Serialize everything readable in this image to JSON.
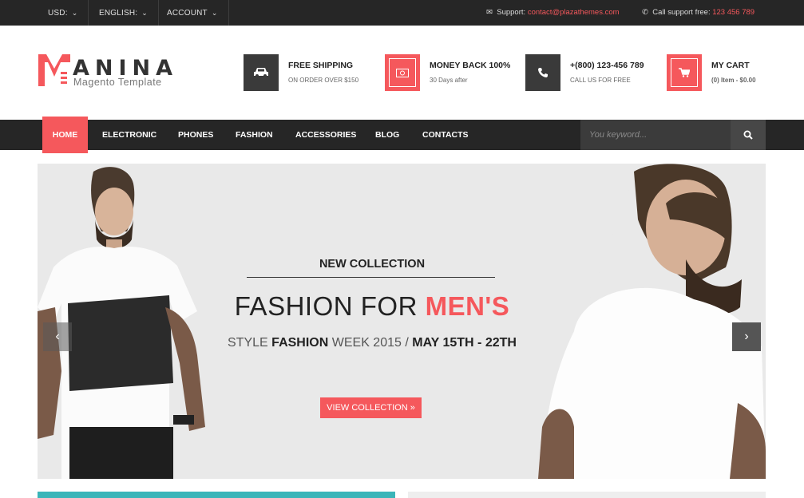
{
  "topbar": {
    "currency": "USD:",
    "language": "ENGLISH:",
    "account": "ACCOUNT",
    "support_label": "Support:",
    "support_email": "contact@plazathemes.com",
    "call_label": "Call support free:",
    "call_number": "123 456 789"
  },
  "logo": {
    "name": "ANINA",
    "tagline": "Magento Template"
  },
  "features": [
    {
      "title": "FREE SHIPPING",
      "sub": "ON ORDER OVER $150",
      "icon": "car-icon"
    },
    {
      "title": "MONEY BACK 100%",
      "sub": "30 Days after",
      "icon": "money-icon"
    },
    {
      "title": "+(800) 123-456 789",
      "sub": "CALL US FOR FREE",
      "icon": "phone-icon"
    },
    {
      "title": "MY CART",
      "sub": "(0) Item - $0.00",
      "icon": "cart-icon"
    }
  ],
  "nav": {
    "home": "HOME",
    "items": [
      "ELECTRONIC",
      "PHONES",
      "FASHION",
      "ACCESSORIES",
      "BLOG",
      "CONTACTS"
    ]
  },
  "search": {
    "placeholder": "You keyword..."
  },
  "hero": {
    "kicker": "NEW COLLECTION",
    "title_a": "FASHION FOR ",
    "title_b": "MEN'S",
    "sub_a": "STYLE ",
    "sub_b": "FASHION",
    "sub_c": " WEEK 2015 / ",
    "sub_d": "MAY 15TH - 22TH",
    "button": "VIEW COLLECTION »"
  },
  "colors": {
    "accent": "#f5585c",
    "dark": "#262626"
  }
}
